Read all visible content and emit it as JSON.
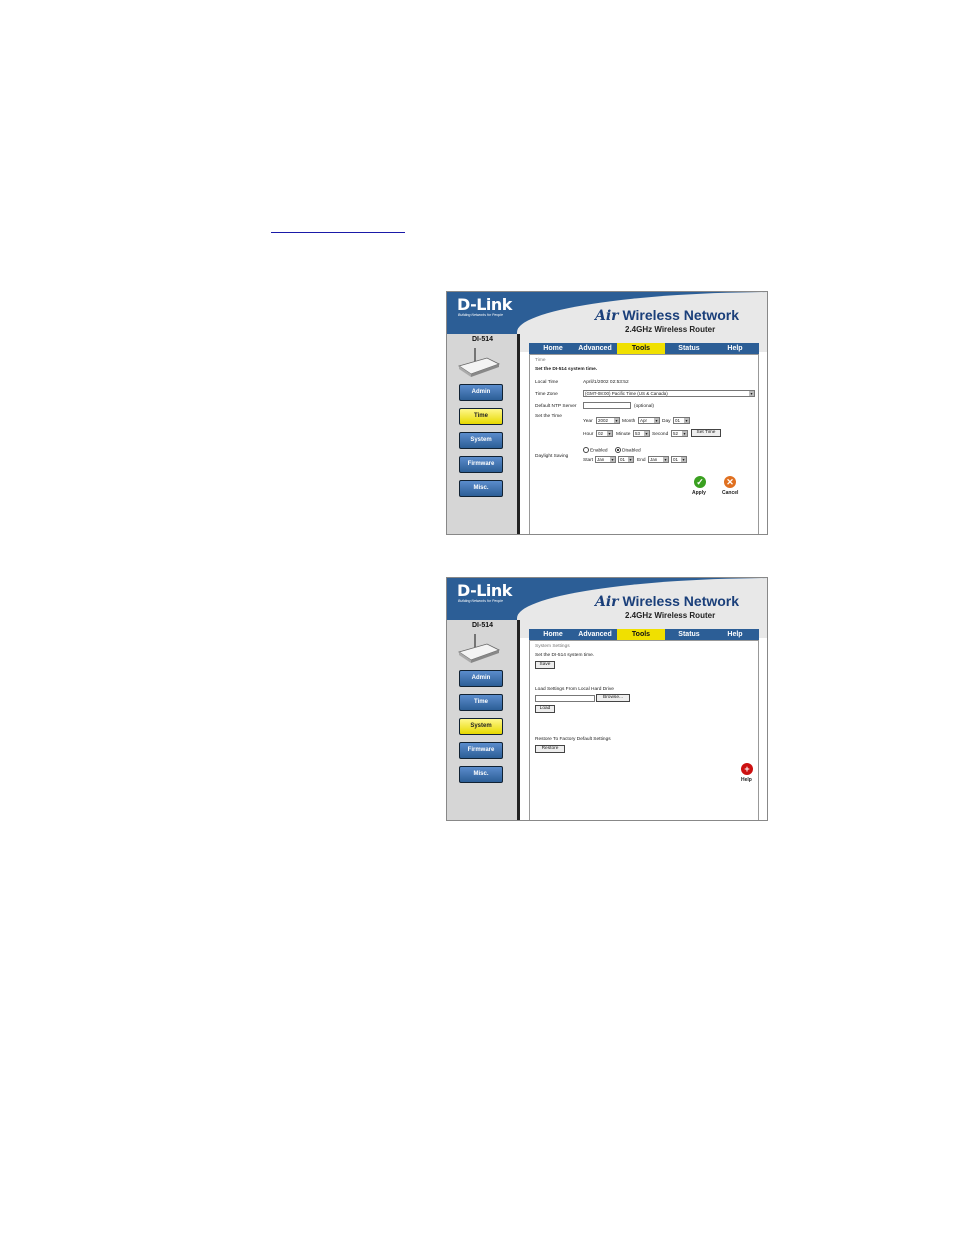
{
  "colors": {
    "brand_blue": "#2c5e96",
    "tab_active": "#f0e000",
    "apply_green": "#3aa020",
    "cancel_orange": "#e07020",
    "help_red": "#cc1010"
  },
  "common": {
    "logo": "D-Link",
    "logo_tagline": "Building Networks for People",
    "brand_air": "Air",
    "brand_title": "Wireless Network",
    "brand_subtitle": "2.4GHz Wireless Router",
    "model": "DI-514",
    "tabs": [
      "Home",
      "Advanced",
      "Tools",
      "Status",
      "Help"
    ],
    "nav": [
      "Admin",
      "Time",
      "System",
      "Firmware",
      "Misc."
    ]
  },
  "time_screen": {
    "section": "Time",
    "heading": "Set the DI-514 system time.",
    "local_time_label": "Local Time",
    "local_time_value": "April/1/2002 02:53:52",
    "time_zone_label": "Time Zone",
    "time_zone_value": "(GMT-08:00) Pacific Time (US & Canada)",
    "ntp_label": "Default NTP Server",
    "ntp_optional": "(optional)",
    "set_time_label": "Set the Time",
    "year_label": "Year",
    "year_value": "2002",
    "month_label": "Month",
    "month_value": "Apr",
    "day_label": "Day",
    "day_value": "01",
    "hour_label": "Hour",
    "hour_value": "02",
    "minute_label": "Minute",
    "minute_value": "53",
    "second_label": "Second",
    "second_value": "52",
    "set_time_button": "Set Time",
    "dst_label": "Daylight Saving",
    "enabled": "Enabled",
    "disabled": "Disabled",
    "start_label": "Start",
    "start_month": "Jan",
    "start_day": "01",
    "end_label": "End",
    "end_month": "Jan",
    "end_day": "01",
    "apply": "Apply",
    "cancel": "Cancel"
  },
  "system_screen": {
    "section": "System Settings",
    "save_text": "Set the DI-514 system time.",
    "save_button": "Save",
    "load_text": "Load Settings From Local Hard Drive",
    "browse_button": "Browse...",
    "load_button": "Load",
    "restore_text": "Restore To Factory Default Settings",
    "restore_button": "Restore",
    "help": "Help"
  }
}
